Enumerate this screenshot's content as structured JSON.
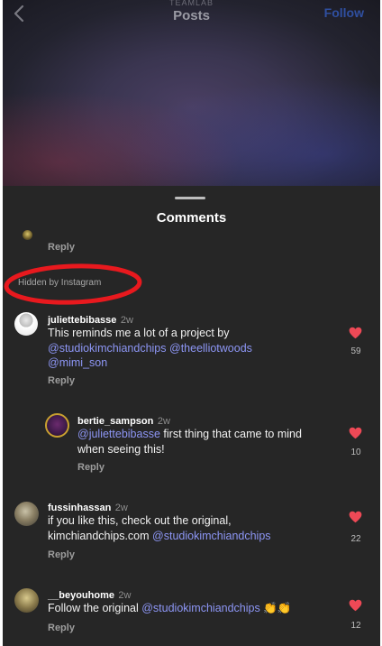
{
  "top_bar": {
    "subtitle": "TEAMLAB",
    "title": "Posts",
    "follow_label": "Follow"
  },
  "sheet": {
    "title": "Comments",
    "first_reply": "Reply",
    "hidden_label": "Hidden by Instagram"
  },
  "comments": [
    {
      "username": "juliettebibasse",
      "time": "2w",
      "text_plain": "This reminds me a lot of a project by",
      "mentions": [
        "@studiokimchiandchips",
        "@theelliotwoods",
        "@mimi_son"
      ],
      "likes": "59",
      "reply": "Reply"
    },
    {
      "username": "bertie_sampson",
      "time": "2w",
      "mention": "@juliettebibasse",
      "text_line1": "first thing that came to mind",
      "text_line2": "when seeing this!",
      "likes": "10",
      "reply": "Reply"
    },
    {
      "username": "fussinhassan",
      "time": "2w",
      "text_line1": "if you like this, check out the original,",
      "text_line2": "kimchiandchips.com",
      "mention": "@studiokimchiandchips",
      "likes": "22",
      "reply": "Reply"
    },
    {
      "username": "__beyouhome",
      "time": "2w",
      "text_plain": "Follow the original",
      "mention": "@studiokimchiandchips",
      "emoji": "👏👏",
      "likes": "12",
      "reply": "Reply"
    }
  ],
  "colors": {
    "sheet_bg": "#262626",
    "mention": "#8d96f5",
    "heart": "#ed4956",
    "annotation": "#e8191e"
  }
}
